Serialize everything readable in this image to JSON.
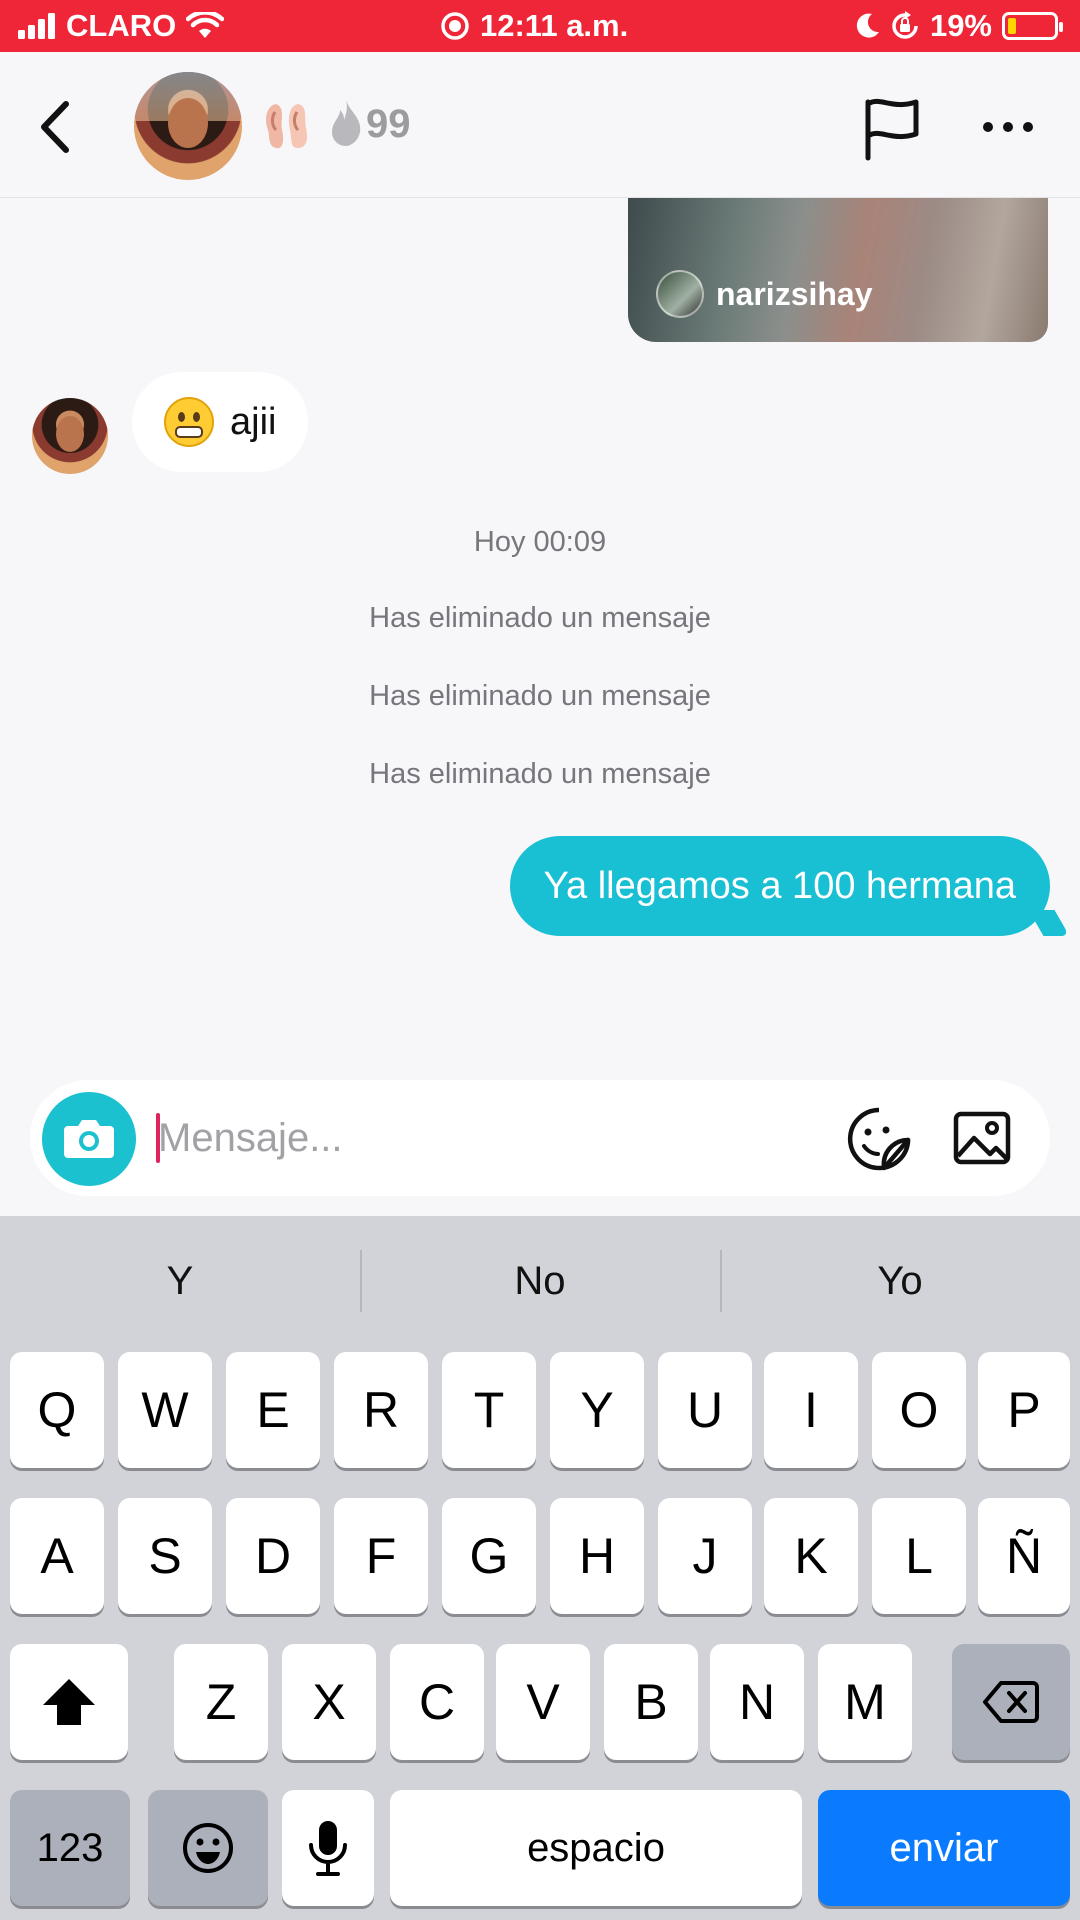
{
  "status_bar": {
    "carrier": "CLARO",
    "time": "12:11 a.m.",
    "battery": "19%",
    "battery_level": 0.19
  },
  "header": {
    "streak_count": "99",
    "icons": [
      "back-chevron-icon",
      "ears-emoji-icon",
      "streak-flame-icon",
      "report-flag-icon",
      "more-dots-icon"
    ]
  },
  "chat": {
    "shared_post_username": "narizsihay",
    "received_emoji": "grimacing-face",
    "received_text": "ajii",
    "timestamp": "Hoy 00:09",
    "deleted_notices": [
      "Has eliminado un mensaje",
      "Has eliminado un mensaje",
      "Has eliminado un mensaje"
    ],
    "sent_text": "Ya llegamos a 100 hermana"
  },
  "composer": {
    "placeholder": "Mensaje...",
    "value": ""
  },
  "keyboard": {
    "suggestions": [
      "Y",
      "No",
      "Yo"
    ],
    "row1": [
      "Q",
      "W",
      "E",
      "R",
      "T",
      "Y",
      "U",
      "I",
      "O",
      "P"
    ],
    "row2": [
      "A",
      "S",
      "D",
      "F",
      "G",
      "H",
      "J",
      "K",
      "L",
      "Ñ"
    ],
    "row3": [
      "Z",
      "X",
      "C",
      "V",
      "B",
      "N",
      "M"
    ],
    "numbers_key": "123",
    "space_key": "espacio",
    "send_key": "enviar"
  },
  "colors": {
    "status_bar": "#ef2637",
    "sent_bubble": "#19bfd3",
    "camera_button": "#1cc1cf",
    "send_key": "#0a7bfe"
  }
}
